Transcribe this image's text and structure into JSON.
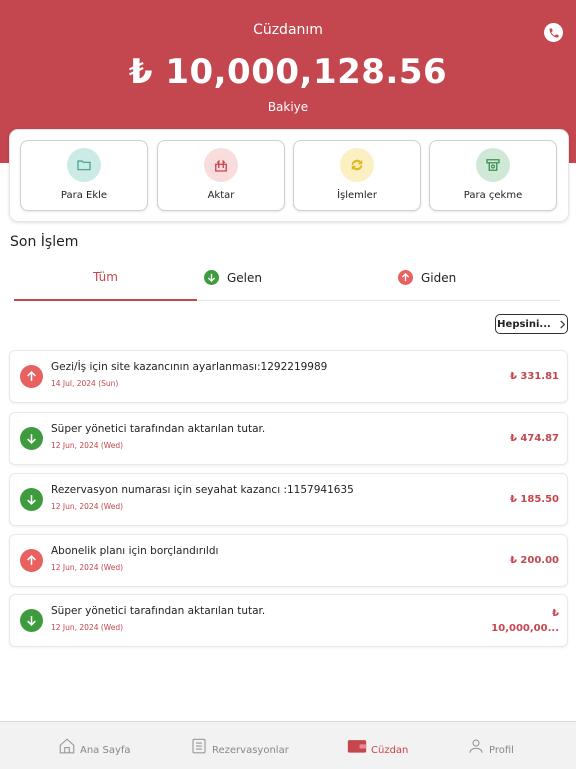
{
  "header": {
    "title": "Cüzdanım",
    "balance": "₺ 10,000,128.56",
    "balance_label": "Bakiye",
    "support_icon": "phone-icon"
  },
  "actions": [
    {
      "label": "Para Ekle",
      "icon": "folder-icon",
      "color": "#cdebe6"
    },
    {
      "label": "Aktar",
      "icon": "transfer-icon",
      "color": "#f9dcdc"
    },
    {
      "label": "İşlemler",
      "icon": "refresh-icon",
      "color": "#fbf0c2"
    },
    {
      "label": "Para çekme",
      "icon": "cash-icon",
      "color": "#cfe9d6"
    }
  ],
  "section_title": "Son İşlem",
  "tabs": [
    {
      "label": "Tüm",
      "active": true
    },
    {
      "label": "Gelen",
      "icon": "arrow-down-icon",
      "color": "#3e9b3e"
    },
    {
      "label": "Giden",
      "icon": "arrow-up-icon",
      "color": "#e86161"
    }
  ],
  "more_button": "Hepsini...",
  "transactions": [
    {
      "direction": "out",
      "description": "Gezi/İş için site kazancının ayarlanması:1292219989",
      "date": "14 Jul, 2024 (Sun)",
      "amount": "₺ 331.81"
    },
    {
      "direction": "in",
      "description": "Süper yönetici tarafından aktarılan tutar.",
      "date": "12 Jun, 2024 (Wed)",
      "amount": "₺ 474.87"
    },
    {
      "direction": "in",
      "description": "Rezervasyon numarası için seyahat kazancı :1157941635",
      "date": "12 Jun, 2024 (Wed)",
      "amount": "₺ 185.50"
    },
    {
      "direction": "out",
      "description": "Abonelik planı için borçlandırıldı",
      "date": "12 Jun, 2024 (Wed)",
      "amount": "₺ 200.00"
    },
    {
      "direction": "in",
      "description": "Süper yönetici tarafından aktarılan tutar.",
      "date": "12 Jun, 2024 (Wed)",
      "amount_line1": "₺",
      "amount_line2": "10,000,00..."
    }
  ],
  "nav": [
    {
      "label": "Ana Sayfa",
      "icon": "home-icon"
    },
    {
      "label": "Rezervasyonlar",
      "icon": "list-icon"
    },
    {
      "label": "Cüzdan",
      "icon": "wallet-icon",
      "active": true
    },
    {
      "label": "Profil",
      "icon": "user-icon"
    }
  ],
  "colors": {
    "accent": "#c4464f",
    "in": "#3e9b3e",
    "out": "#e86161"
  }
}
